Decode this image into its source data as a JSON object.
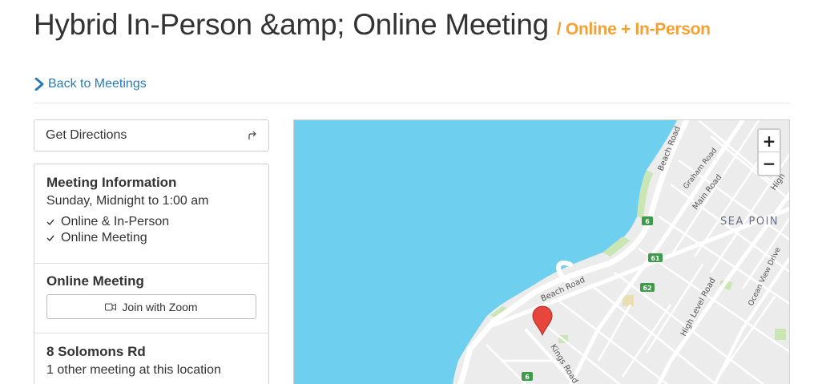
{
  "header": {
    "title": "Hybrid In-Person &amp; Online Meeting",
    "type_label": "/ Online + In-Person",
    "back_link": "Back to Meetings"
  },
  "directions": {
    "label": "Get Directions"
  },
  "meeting_info": {
    "heading": "Meeting Information",
    "schedule": "Sunday, Midnight to 1:00 am",
    "types": [
      "Online & In-Person",
      "Online Meeting"
    ]
  },
  "online": {
    "heading": "Online Meeting",
    "join_label": "Join with Zoom"
  },
  "location": {
    "heading": "8 Solomons Rd",
    "other_meetings": "1 other meeting at this location"
  },
  "map": {
    "labels": {
      "beach_road_1": "Beach Road",
      "graham_road": "Graham Road",
      "main_road": "Main Road",
      "high": "High",
      "sea_point": "SEA POIN",
      "beach_road_2": "Beach Road",
      "high_level_road": "High Level Road",
      "ocean_view_drive": "Ocean View Drive",
      "kings_road": "Kings Road"
    },
    "route_shields": [
      "6",
      "61",
      "62",
      "6"
    ],
    "zoom_in": "+",
    "zoom_out": "−",
    "colors": {
      "water": "#6ecfee",
      "land": "#ececec",
      "road": "#ffffff",
      "park": "#c9e6b4",
      "marker": "#e8453c",
      "shield": "#3d9b4a"
    }
  }
}
